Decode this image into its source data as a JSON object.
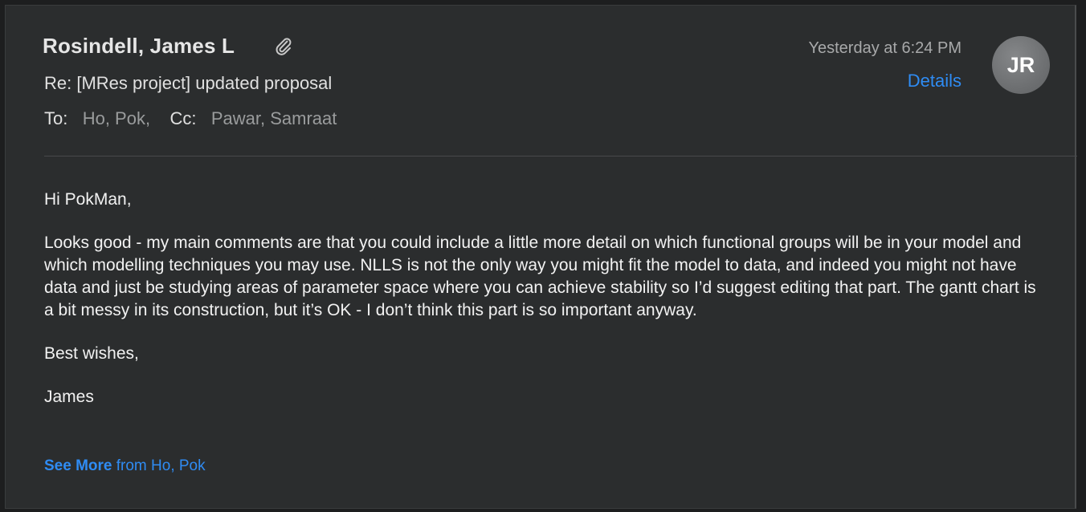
{
  "header": {
    "sender": "Rosindell, James L",
    "subject": "Re: [MRes project] updated proposal",
    "to_label": "To:",
    "to_value": "Ho, Pok,",
    "cc_label": "Cc:",
    "cc_value": "Pawar, Samraat",
    "timestamp": "Yesterday at 6:24 PM",
    "details_label": "Details",
    "avatar_initials": "JR",
    "attachment_icon": "paperclip-icon"
  },
  "body": {
    "greeting": "Hi PokMan,",
    "paragraph": "Looks good - my main comments are that you could include a little more detail on which functional groups will be in your model and which modelling techniques you may use.  NLLS is not the only way you might fit the model to data, and indeed you might not have data and just be studying areas of parameter space where you can achieve stability so I’d suggest editing that part.  The gantt chart is a bit messy in its construction, but it’s OK - I don’t think this part is so important anyway.",
    "signoff": "Best wishes,",
    "signature": "James"
  },
  "footer": {
    "see_more_label": "See More",
    "see_more_suffix": " from Ho, Pok"
  },
  "colors": {
    "background": "#2b2d2e",
    "link": "#2f8cf4",
    "text": "#f2f2f2",
    "muted": "#9a9c9d"
  }
}
